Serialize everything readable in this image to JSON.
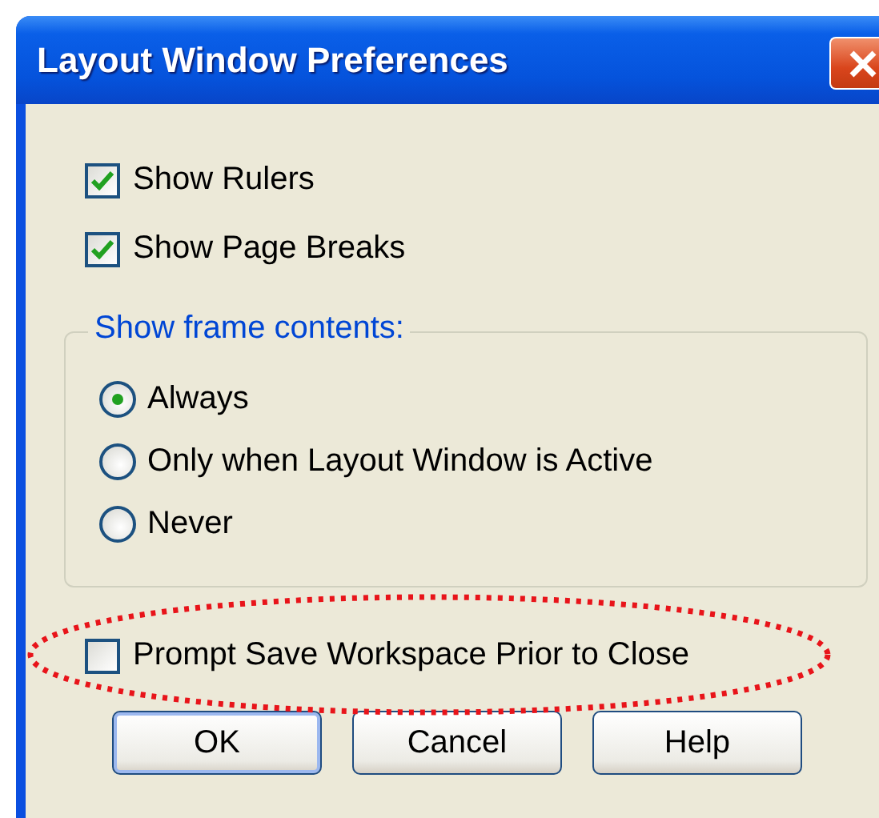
{
  "window": {
    "title": "Layout Window Preferences"
  },
  "checkboxes": [
    {
      "label": "Show Rulers",
      "checked": true
    },
    {
      "label": "Show Page Breaks",
      "checked": true
    }
  ],
  "frame_group": {
    "legend": "Show frame contents:",
    "options": [
      {
        "label": "Always",
        "selected": true
      },
      {
        "label": "Only when Layout Window is Active",
        "selected": false
      },
      {
        "label": "Never",
        "selected": false
      }
    ]
  },
  "prompt_checkbox": {
    "label": "Prompt Save Workspace Prior to Close",
    "checked": false,
    "highlighted": true
  },
  "buttons": [
    {
      "label": "OK",
      "default": true
    },
    {
      "label": "Cancel",
      "default": false
    },
    {
      "label": "Help",
      "default": false
    }
  ]
}
